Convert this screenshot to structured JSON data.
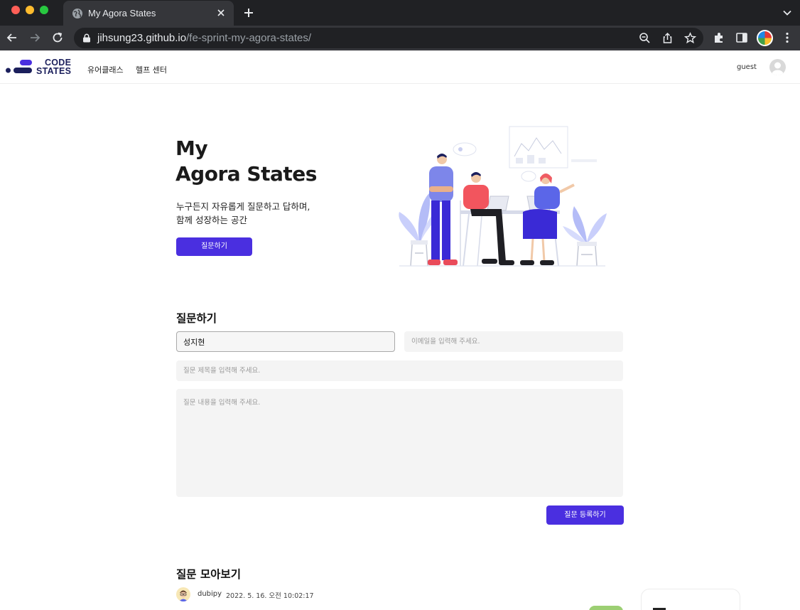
{
  "browser": {
    "tab_title": "My Agora States",
    "url_host": "jihsung23.github.io",
    "url_path": "/fe-sprint-my-agora-states/"
  },
  "site": {
    "logo_line1": "CODE",
    "logo_line2": "STATES",
    "nav": [
      {
        "label": "유어클래스"
      },
      {
        "label": "헬프 센터"
      }
    ],
    "user_label": "guest"
  },
  "hero": {
    "title_line1": "My",
    "title_line2": "Agora States",
    "subtitle_line1": "누구든지 자유롭게 질문하고 답하며,",
    "subtitle_line2": "함께 성장하는 공간",
    "button_label": "질문하기"
  },
  "form": {
    "heading": "질문하기",
    "name_value": "성지현",
    "email_placeholder": "이메일을 입력해 주세요.",
    "title_placeholder": "질문 제목을 입력해 주세요.",
    "body_placeholder": "질문 내용을 입력해 주세요.",
    "submit_label": "질문 등록하기"
  },
  "list": {
    "heading": "질문 모아보기",
    "items": [
      {
        "author": "dubipy",
        "date": "2022. 5. 16. 오전 10:02:17"
      }
    ]
  },
  "colors": {
    "accent": "#4a2fe0",
    "brand_navy": "#1b1f5c",
    "answered_badge": "#9ccf73"
  }
}
